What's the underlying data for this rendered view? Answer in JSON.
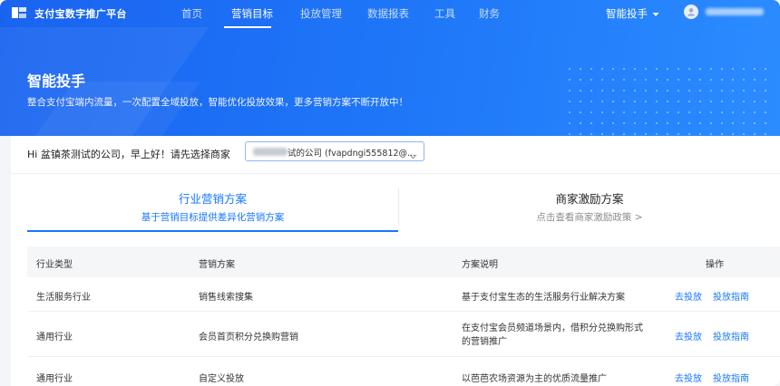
{
  "header": {
    "brand": "支付宝数字推广平台",
    "nav": [
      "首页",
      "营销目标",
      "投放管理",
      "数据报表",
      "工具",
      "财务"
    ],
    "active_nav": "营销目标",
    "smart_tool": "智能投手"
  },
  "hero": {
    "title": "智能投手",
    "subtitle": "整合支付宝端内流量，一次配置全域投放，智能优化投放效果，更多营销方案不断开放中！"
  },
  "merchant": {
    "greeting": "Hi 盆镇茶测试的公司，早上好！请先选择商家",
    "selected": "试的公司 (fvapdngi555812@..."
  },
  "tabs": [
    {
      "title": "行业营销方案",
      "subtitle": "基于营销目标提供差异化营销方案",
      "active": true
    },
    {
      "title": "商家激励方案",
      "subtitle": "点击查看商家激励政策 >",
      "active": false
    }
  ],
  "table": {
    "headers": [
      "行业类型",
      "营销方案",
      "方案说明",
      "操作"
    ],
    "rows": [
      {
        "industry": "生活服务行业",
        "plan": "销售线索搜集",
        "desc": "基于支付宝生态的生活服务行业解决方案",
        "action1": "去投放",
        "action2": "投放指南"
      },
      {
        "industry": "通用行业",
        "plan": "会员首页积分兑换购营销",
        "desc": "在支付宝会员频道场景内，借积分兑换购形式的营销推广",
        "action1": "去投放",
        "action2": "投放指南"
      },
      {
        "industry": "通用行业",
        "plan": "自定义投放",
        "desc": "以芭芭农场资源为主的优质流量推广",
        "action1": "去投放",
        "action2": "投放指南"
      }
    ]
  },
  "colors": {
    "primary": "#1677ff",
    "hero": "#1a63f0"
  },
  "icons": [
    "logo-icon",
    "chevron-down-icon",
    "user-avatar-icon",
    "select-chevron-icon"
  ]
}
